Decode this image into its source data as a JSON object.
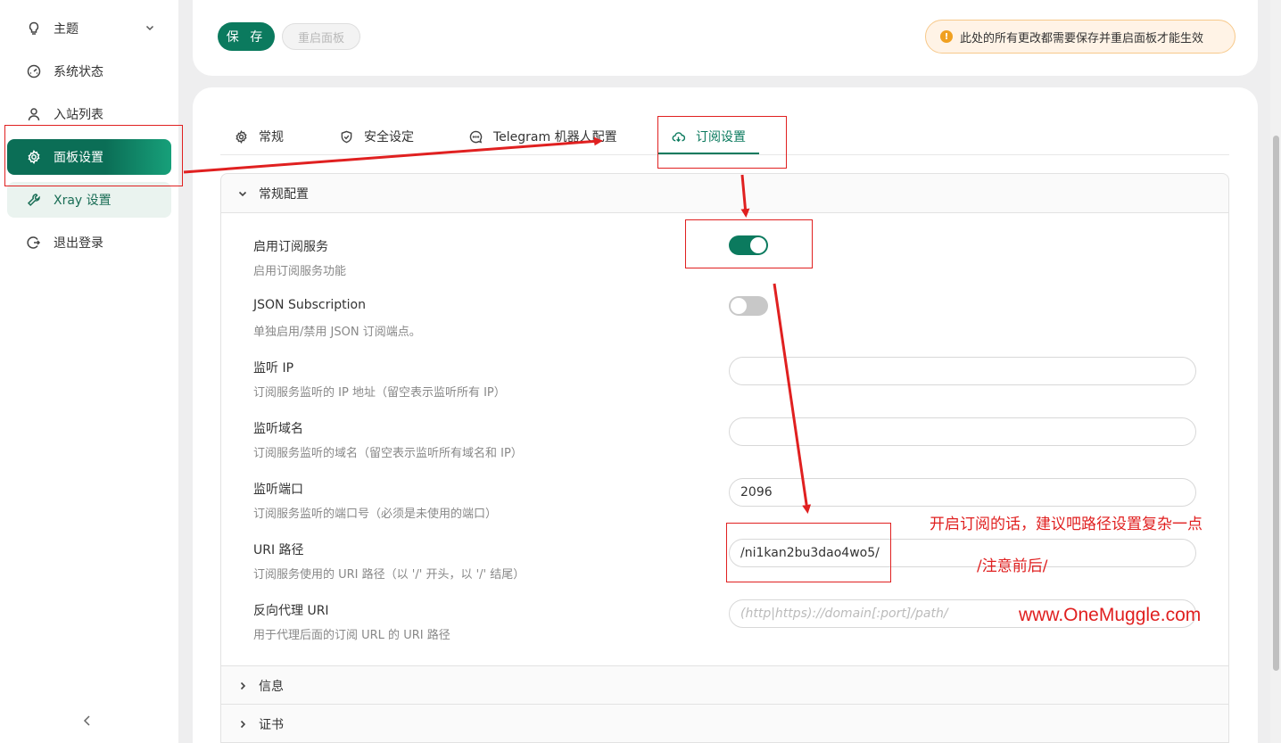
{
  "sidebar": {
    "items": [
      {
        "label": "主题",
        "icon": "lightbulb-icon"
      },
      {
        "label": "系统状态",
        "icon": "dashboard-icon"
      },
      {
        "label": "入站列表",
        "icon": "user-icon"
      },
      {
        "label": "面板设置",
        "icon": "gear-icon"
      },
      {
        "label": "Xray 设置",
        "icon": "wrench-icon"
      },
      {
        "label": "退出登录",
        "icon": "logout-icon"
      }
    ],
    "collapse_icon": "chevron-left-icon"
  },
  "toolbar": {
    "save_label": "保 存",
    "restart_label": "重启面板",
    "alert_text": "此处的所有更改都需要保存并重启面板才能生效",
    "alert_icon": "warning-icon"
  },
  "tabs": [
    {
      "label": "常规",
      "icon": "gear-icon"
    },
    {
      "label": "安全设定",
      "icon": "shield-icon"
    },
    {
      "label": "Telegram 机器人配置",
      "icon": "chat-icon"
    },
    {
      "label": "订阅设置",
      "icon": "cloud-icon"
    }
  ],
  "panels": {
    "general": {
      "title": "常规配置"
    },
    "info": {
      "title": "信息"
    },
    "cert": {
      "title": "证书"
    }
  },
  "settings": {
    "enable_sub": {
      "label": "启用订阅服务",
      "desc": "启用订阅服务功能",
      "on": true
    },
    "json_sub": {
      "label": "JSON Subscription",
      "desc": "单独启用/禁用 JSON 订阅端点。",
      "on": false
    },
    "listen_ip": {
      "label": "监听 IP",
      "desc": "订阅服务监听的 IP 地址（留空表示监听所有 IP）",
      "value": ""
    },
    "listen_domain": {
      "label": "监听域名",
      "desc": "订阅服务监听的域名（留空表示监听所有域名和 IP）",
      "value": ""
    },
    "listen_port": {
      "label": "监听端口",
      "desc": "订阅服务监听的端口号（必须是未使用的端口）",
      "value": "2096"
    },
    "uri_path": {
      "label": "URI 路径",
      "desc": "订阅服务使用的 URI 路径（以 '/' 开头，以 '/' 结尾）",
      "value": "/ni1kan2bu3dao4wo5/"
    },
    "reverse_uri": {
      "label": "反向代理 URI",
      "desc": "用于代理后面的订阅 URL 的 URI 路径",
      "placeholder": "(http|https)://domain[:port]/path/"
    }
  },
  "annotations": {
    "tip1": "开启订阅的话，建议吧路径设置复杂一点",
    "tip2": "/注意前后/",
    "watermark": "www.OneMuggle.com",
    "color": "#e02020"
  },
  "colors": {
    "accent": "#0b7a5e",
    "annotation": "#e02020"
  }
}
